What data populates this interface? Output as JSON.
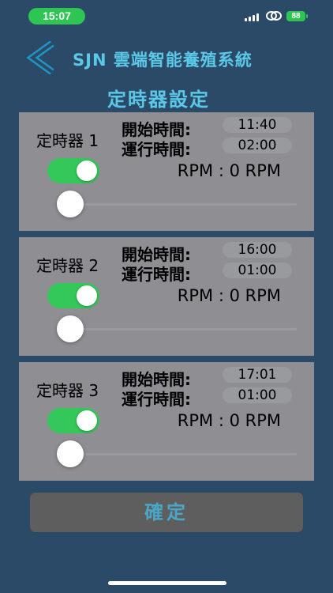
{
  "status_bar": {
    "time": "15:07",
    "battery": "88"
  },
  "header": {
    "title": "SJN 雲端智能養殖系統"
  },
  "page_title": "定時器設定",
  "labels": {
    "start": "開始時間:",
    "run": "運行時間:"
  },
  "timers": [
    {
      "name": "定時器 1",
      "start_time": "11:40",
      "run_time": "02:00",
      "rpm": "RPM : 0 RPM",
      "enabled": true,
      "rpm_slider": 0
    },
    {
      "name": "定時器 2",
      "start_time": "16:00",
      "run_time": "01:00",
      "rpm": "RPM : 0 RPM",
      "enabled": true,
      "rpm_slider": 0
    },
    {
      "name": "定時器 3",
      "start_time": "17:01",
      "run_time": "01:00",
      "rpm": "RPM : 0 RPM",
      "enabled": true,
      "rpm_slider": 0
    }
  ],
  "confirm_label": "確定",
  "colors": {
    "background": "#2b4a67",
    "accent": "#5bc8e8",
    "toggle_on": "#34c759",
    "card": "#8e8e93"
  }
}
